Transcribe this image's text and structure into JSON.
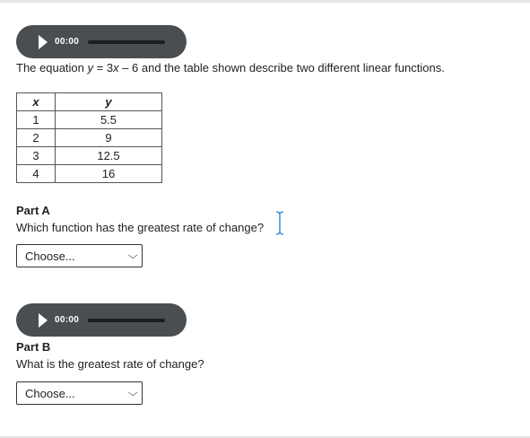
{
  "audio_players": [
    {
      "time": "00:00"
    },
    {
      "time": "00:00"
    }
  ],
  "intro": {
    "before": "The equation ",
    "eq_y": "y",
    "eq_mid": " = 3",
    "eq_x": "x",
    "after": " – 6 and the table shown describe two different linear functions."
  },
  "table": {
    "headers": [
      "x",
      "y"
    ],
    "rows": [
      [
        "1",
        "5.5"
      ],
      [
        "2",
        "9"
      ],
      [
        "3",
        "12.5"
      ],
      [
        "4",
        "16"
      ]
    ]
  },
  "part_a": {
    "heading": "Part A",
    "question": "Which function has the greatest rate of change?",
    "select_value": "Choose..."
  },
  "part_b": {
    "heading": "Part B",
    "question": "What is the greatest rate of change?",
    "select_value": "Choose..."
  },
  "colors": {
    "audio_bg": "#4a4e51",
    "cursor": "#1f7fd1"
  },
  "icons": {
    "play": "play-icon",
    "dropdown": "chevron-down-icon",
    "cursor": "text-cursor-icon"
  }
}
